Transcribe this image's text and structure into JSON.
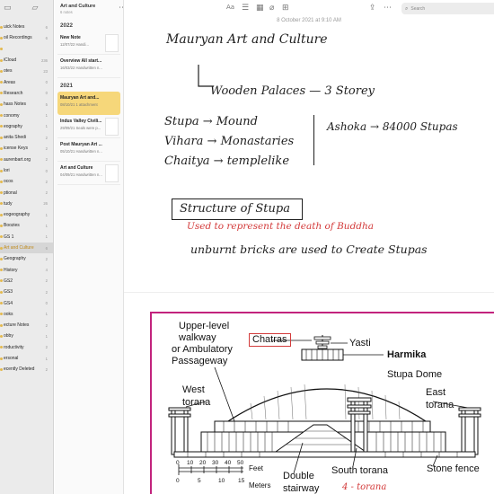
{
  "sidebar": {
    "items": [
      {
        "label": "uick Notes",
        "count": "6"
      },
      {
        "label": "oil Recordings",
        "count": "6"
      },
      {
        "label": "",
        "count": ""
      },
      {
        "label": "iCloud",
        "count": "236"
      },
      {
        "label": "otes",
        "count": "23"
      },
      {
        "label": "Areas",
        "count": "0"
      },
      {
        "label": "Research",
        "count": "0"
      },
      {
        "label": "hass Notes",
        "count": "5"
      },
      {
        "label": "conomy",
        "count": "1"
      },
      {
        "label": "eography",
        "count": "1"
      },
      {
        "label": "anita Shedi",
        "count": "2"
      },
      {
        "label": "icense Keys",
        "count": "2"
      },
      {
        "label": "aurenbart.org",
        "count": "2"
      },
      {
        "label": "lori",
        "count": "0"
      },
      {
        "label": "ocos",
        "count": "2"
      },
      {
        "label": "ptional",
        "count": "2"
      },
      {
        "label": "tudy",
        "count": "26"
      },
      {
        "label": "eogeography",
        "count": "1"
      },
      {
        "label": "Boozies",
        "count": "1"
      },
      {
        "label": "GS 1",
        "count": "1"
      },
      {
        "label": "Art and Culture",
        "count": "6"
      },
      {
        "label": "Geography",
        "count": "2"
      },
      {
        "label": "History",
        "count": "4"
      },
      {
        "label": "GS2",
        "count": "2"
      },
      {
        "label": "GS3",
        "count": "2"
      },
      {
        "label": "GS4",
        "count": "0"
      },
      {
        "label": "ooks",
        "count": "1"
      },
      {
        "label": "ecture Notes",
        "count": "2"
      },
      {
        "label": "obby",
        "count": "1"
      },
      {
        "label": "roductivity",
        "count": "2"
      },
      {
        "label": "ersonal",
        "count": "1"
      },
      {
        "label": "ecently Deleted",
        "count": "2"
      }
    ]
  },
  "notelist": {
    "title": "Art and Culture",
    "count": "6 notes",
    "years": [
      "2022",
      "2021"
    ],
    "notes_2022": [
      {
        "title": "New Note",
        "meta": "12/07/22  Handi..."
      },
      {
        "title": "Overview All start...",
        "meta": "16/03/22  Handwritten n..."
      }
    ],
    "notes_2021": [
      {
        "title": "Mauryan Art and...",
        "meta": "08/10/21  1 attachment"
      },
      {
        "title": "Indus Valley Civili...",
        "meta": "29/09/21  Seals were p..."
      },
      {
        "title": "Post Mauryan Art ...",
        "meta": "05/10/21  Handwritten n..."
      },
      {
        "title": "Art and Culture",
        "meta": "04/09/21  Handwritten n..."
      }
    ]
  },
  "editor": {
    "date": "8 October 2021 at 9:10 AM",
    "search_placeholder": "Search",
    "handwriting": {
      "title": "Mauryan Art and Culture",
      "wooden": "Wooden Palaces  —  3 Storey",
      "stupa": "Stupa → Mound",
      "vihara": "Vihara → Monastaries",
      "chaitya": "Chaitya → templelike",
      "ashoka": "Ashoka → 84000 Stupas",
      "structure": "Structure of Stupa",
      "used": "Used to represent the death of Buddha",
      "bricks": "unburnt bricks are used to Create Stupas",
      "torana_note": "4 - torana"
    },
    "figure": {
      "upper": "Upper-level",
      "walkway": "walkway",
      "ambulatory": "or Ambulatory",
      "passageway": "Passageway",
      "chatras": "Chatras",
      "yasti": "Yasti",
      "harmika": "Harmika",
      "dome": "Stupa Dome",
      "west": "West",
      "west_torana": "torana",
      "east": "East",
      "east_torana": "torana",
      "stone_fence": "Stone fence",
      "double": "Double",
      "stairway": "stairway",
      "south_torana": "South torana",
      "feet": "Feet",
      "meters": "Meters",
      "feet_ticks": [
        "0",
        "10",
        "20",
        "30",
        "40",
        "50"
      ],
      "meter_ticks": [
        "0",
        "5",
        "10",
        "15"
      ]
    }
  },
  "icons": {
    "sidebar_toggle": "sidebar-icon",
    "new_folder": "folder-icon",
    "gallery": "gallery-icon",
    "more": "ellipsis-icon",
    "compose": "compose-icon",
    "format": "format-icon",
    "checklist": "checklist-icon",
    "table": "table-icon",
    "attachment": "paperclip-icon",
    "link": "link-icon",
    "share": "share-icon",
    "search": "search-icon"
  },
  "colors": {
    "selected_note": "#f6d77a",
    "folder_dot": "#e3b94e",
    "figure_border": "#c2237d",
    "red_ink": "#d33a3a"
  }
}
